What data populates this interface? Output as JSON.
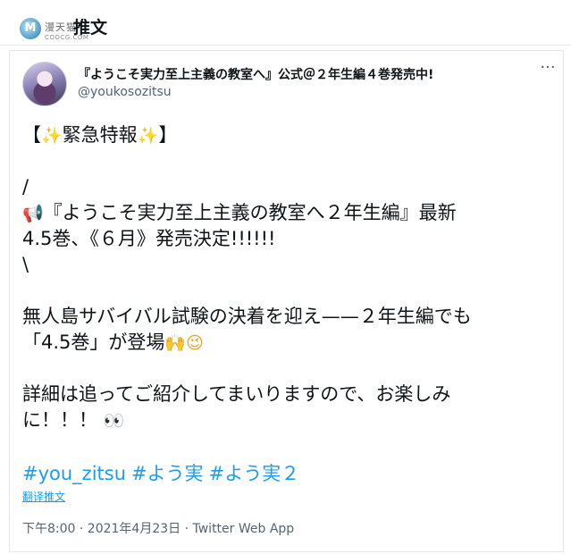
{
  "header": {
    "watermark_text": "漫天猫",
    "watermark_sub": "COOCG.COM",
    "watermark_logo_letter": "M",
    "title": "推文"
  },
  "tweet": {
    "author_name": "『ようこそ実力至上主義の教室へ』公式＠２年生編４巻発売中!",
    "author_handle": "@youkosozitsu",
    "more_icon": "more-horizontal-icon",
    "body": {
      "line1": {
        "prefix": "【",
        "emoji_a": "✨",
        "text": "緊急特報",
        "emoji_b": "✨",
        "suffix": "】"
      },
      "line2": "/",
      "line3": {
        "emoji": "📢",
        "text": "『ようこそ実力至上主義の教室へ２年生編』最新"
      },
      "line4": "4.5巻、《６月》発売決定!!!!!!",
      "line5": "\\",
      "line6": "無人島サバイバル試験の決着を迎え——２年生編でも",
      "line7": {
        "text": "「4.5巻」が登場",
        "emoji_a": "🙌",
        "emoji_b": "😉"
      },
      "line8": "詳細は追ってご紹介してまいりますので、お楽しみ",
      "line9": {
        "text": "に！！！",
        "emoji": "👀"
      }
    },
    "hashtags": [
      "#you_zitsu",
      "#よう実",
      "#よう実２"
    ],
    "translate_label": "翻译推文",
    "timestamp": "下午8:00 · 2021年4月23日 · Twitter Web App"
  },
  "colors": {
    "link": "#1d9bf0",
    "secondary_text": "#536471",
    "primary_text": "#0f1419",
    "border": "#e3e3e3"
  }
}
